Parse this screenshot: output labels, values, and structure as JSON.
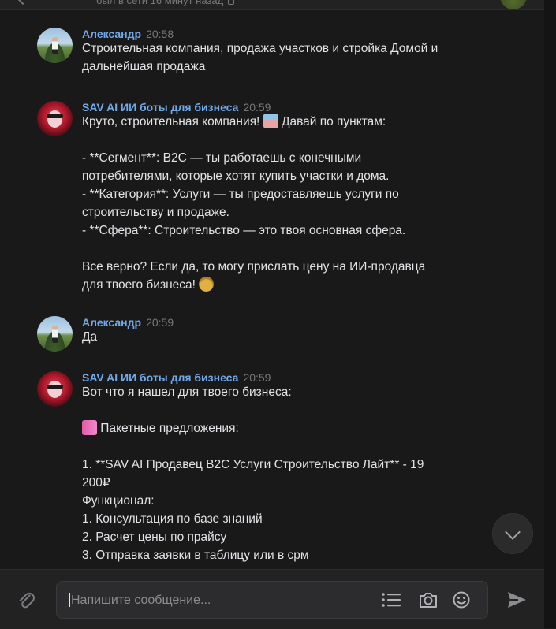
{
  "header": {
    "status": "был в сети 16 минут назад"
  },
  "messages": [
    {
      "author": "Александр",
      "time": "20:58",
      "text": "Строительная компания, продажа участков и стройка Домой и\nдальнейшая продажа"
    },
    {
      "author": "SAV AI ИИ боты для бизнеса",
      "time": "20:59",
      "text_parts": [
        "Круто, строительная компания! ",
        " Давай по пунктам:\n\n- **Сегмент**: B2C — ты работаешь с конечными\nпотребителями, которые хотят купить участки и дома.\n- **Категория**: Услуги — ты предоставляешь услуги по\nстроительству и продаже.\n- **Сфера**: Строительство — это твоя основная сфера.\n\nВсе верно? Если да, то могу прислать цену на ИИ-продавца\nдля твоего бизнеса! "
      ],
      "emoji": [
        "building-emoji",
        "moneybag-emoji"
      ]
    },
    {
      "author": "Александр",
      "time": "20:59",
      "text": "Да"
    },
    {
      "author": "SAV AI ИИ боты для бизнеса",
      "time": "20:59",
      "text_parts": [
        "Вот что я нашел для твоего бизнеса:\n\n",
        " Пакетные предложения:\n\n1. **SAV AI Продавец B2C Услуги Строительство Лайт** - 19\n200₽\nФункционал:\n1. Консультация по базе знаний\n2. Расчет цены по прайсу\n3. Отправка заявки в таблицу или в срм"
      ],
      "emoji": [
        "shopping-bags-emoji"
      ]
    }
  ],
  "composer": {
    "placeholder": "Напишите сообщение..."
  },
  "colors": {
    "background": "#19191a",
    "author_link": "#71aaeb",
    "text": "#e1e3e6",
    "muted": "#76787a"
  }
}
